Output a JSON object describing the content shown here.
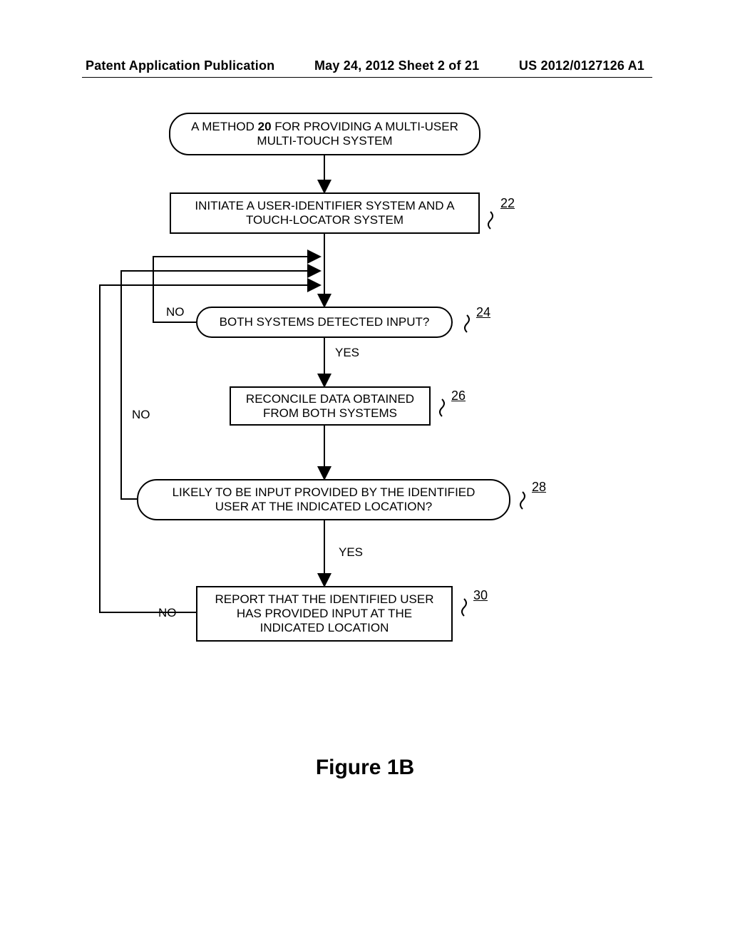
{
  "header": {
    "left": "Patent Application Publication",
    "center": "May 24, 2012  Sheet 2 of 21",
    "right": "US 2012/0127126 A1"
  },
  "nodes": {
    "start": {
      "line1_prefix": "A METHOD ",
      "bold": "20",
      "line1_suffix": " FOR PROVIDING A MULTI-USER",
      "line2": "MULTI-TOUCH SYSTEM"
    },
    "n22": {
      "line1": "INITIATE A USER-IDENTIFIER SYSTEM AND A",
      "line2": "TOUCH-LOCATOR SYSTEM",
      "ref": "22"
    },
    "n24": {
      "line1": "BOTH SYSTEMS DETECTED INPUT?",
      "ref": "24"
    },
    "n26": {
      "line1": "RECONCILE DATA OBTAINED",
      "line2": "FROM BOTH SYSTEMS",
      "ref": "26"
    },
    "n28": {
      "line1": "LIKELY TO BE INPUT PROVIDED BY THE IDENTIFIED",
      "line2": "USER AT THE INDICATED LOCATION?",
      "ref": "28"
    },
    "n30": {
      "line1": "REPORT THAT THE IDENTIFIED USER",
      "line2": "HAS PROVIDED INPUT AT THE",
      "line3": "INDICATED LOCATION",
      "ref": "30"
    }
  },
  "labels": {
    "yes24": "YES",
    "yes28": "YES",
    "no24": "NO",
    "no28": "NO",
    "no30": "NO"
  },
  "figure": "Figure 1B"
}
